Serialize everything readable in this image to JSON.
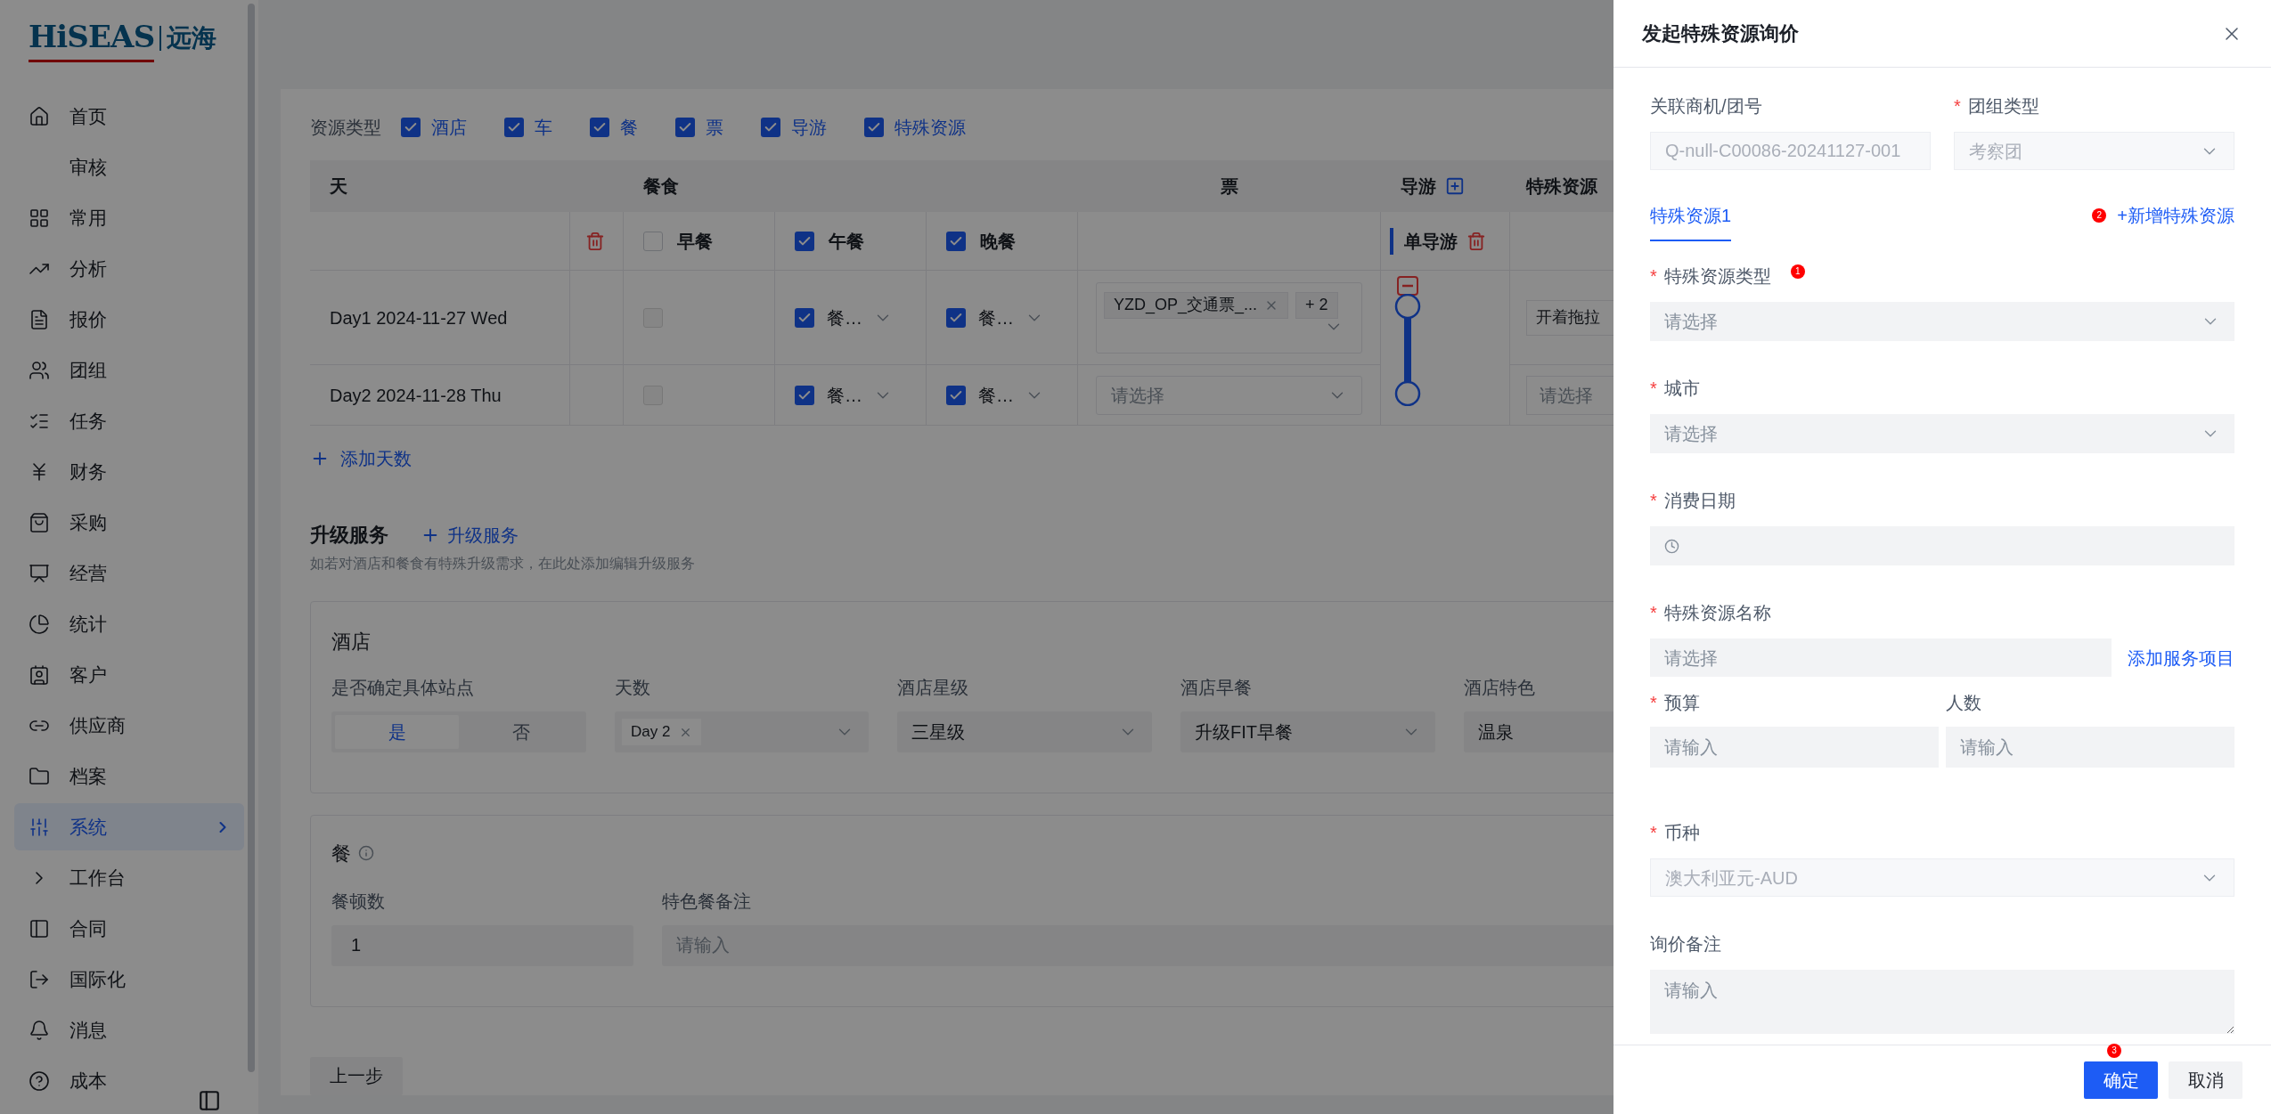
{
  "logo": {
    "brand": "HiSEAS",
    "cn": "远海"
  },
  "sidebar": {
    "items": [
      {
        "label": "首页",
        "selected": false,
        "expandable": false
      },
      {
        "label": "审核",
        "selected": false,
        "expandable": false
      },
      {
        "label": "常用",
        "selected": false,
        "expandable": false
      },
      {
        "label": "分析",
        "selected": false,
        "expandable": false
      },
      {
        "label": "报价",
        "selected": false,
        "expandable": false
      },
      {
        "label": "团组",
        "selected": false,
        "expandable": false
      },
      {
        "label": "任务",
        "selected": false,
        "expandable": false
      },
      {
        "label": "财务",
        "selected": false,
        "expandable": false
      },
      {
        "label": "采购",
        "selected": false,
        "expandable": false
      },
      {
        "label": "经营",
        "selected": false,
        "expandable": false
      },
      {
        "label": "统计",
        "selected": false,
        "expandable": false
      },
      {
        "label": "客户",
        "selected": false,
        "expandable": false
      },
      {
        "label": "供应商",
        "selected": false,
        "expandable": false
      },
      {
        "label": "档案",
        "selected": false,
        "expandable": false
      },
      {
        "label": "系统",
        "selected": true,
        "expandable": true
      },
      {
        "label": "工作台",
        "selected": false,
        "expandable": false
      },
      {
        "label": "合同",
        "selected": false,
        "expandable": false
      },
      {
        "label": "国际化",
        "selected": false,
        "expandable": false
      },
      {
        "label": "消息",
        "selected": false,
        "expandable": false
      },
      {
        "label": "成本",
        "selected": false,
        "expandable": false
      }
    ]
  },
  "resource_types": {
    "label": "资源类型",
    "options": [
      {
        "label": "酒店",
        "checked": true
      },
      {
        "label": "车",
        "checked": true
      },
      {
        "label": "餐",
        "checked": true
      },
      {
        "label": "票",
        "checked": true
      },
      {
        "label": "导游",
        "checked": true
      },
      {
        "label": "特殊资源",
        "checked": true
      }
    ]
  },
  "table": {
    "columns": {
      "day": "天",
      "meals": "餐食",
      "ticket": "票",
      "guide": "导游",
      "special": "特殊资源"
    },
    "meal_columns": [
      {
        "label": "早餐",
        "checked": false
      },
      {
        "label": "午餐",
        "checked": true
      },
      {
        "label": "晚餐",
        "checked": true
      }
    ],
    "guide_mode": "单导游",
    "rows": [
      {
        "day": "Day1 2024-11-27 Wed",
        "meals": [
          {
            "checked": false
          },
          {
            "checked": true,
            "value": "餐…"
          },
          {
            "checked": true,
            "value": "餐…"
          }
        ],
        "ticket": {
          "tags": [
            "YZD_OP_交通票_..."
          ],
          "more": "+ 2"
        },
        "special": {
          "value": "开着拖拉"
        }
      },
      {
        "day": "Day2 2024-11-28 Thu",
        "meals": [
          {
            "checked": false
          },
          {
            "checked": true,
            "value": "餐…"
          },
          {
            "checked": true,
            "value": "餐…"
          }
        ],
        "ticket": {
          "placeholder": "请选择"
        },
        "special": {
          "placeholder": "请选择"
        }
      }
    ]
  },
  "add_day": "添加天数",
  "upgrade": {
    "title": "升级服务",
    "add": "升级服务",
    "hint": "如若对酒店和餐食有特殊升级需求，在此处添加编辑升级服务"
  },
  "hotel": {
    "title": "酒店",
    "site_label": "是否确定具体站点",
    "site_options": [
      {
        "label": "是",
        "selected": true
      },
      {
        "label": "否",
        "selected": false
      }
    ],
    "days_label": "天数",
    "days_tags": [
      "Day 2"
    ],
    "star_label": "酒店星级",
    "star_value": "三星级",
    "breakfast_label": "酒店早餐",
    "breakfast_value": "升级FIT早餐",
    "feature_label": "酒店特色",
    "feature_value": "温泉"
  },
  "meal": {
    "title": "餐",
    "count_label": "餐顿数",
    "count_value": "1",
    "note_label": "特色餐备注",
    "note_placeholder": "请输入"
  },
  "prev_button": "上一步",
  "drawer": {
    "title": "发起特殊资源询价",
    "required_mark": "*",
    "link_label": "关联商机/团号",
    "link_value": "Q-null-C00086-20241127-001",
    "group_type_label": "团组类型",
    "group_type_value": "考察团",
    "tabs": [
      {
        "label": "特殊资源1",
        "selected": true
      }
    ],
    "add_resource": "+新增特殊资源",
    "add_badge": "2",
    "fields": [
      {
        "kind": "select",
        "label": "特殊资源类型",
        "required": true,
        "placeholder": "请选择",
        "badge": "1"
      },
      {
        "kind": "select",
        "label": "城市",
        "required": true,
        "placeholder": "请选择"
      },
      {
        "kind": "date",
        "label": "消费日期",
        "required": true
      },
      {
        "kind": "picker",
        "label": "特殊资源名称",
        "required": true,
        "placeholder": "请选择",
        "action": "添加服务项目"
      }
    ],
    "budget": {
      "label": "预算",
      "required": true,
      "placeholder": "请输入"
    },
    "people": {
      "label": "人数",
      "required": false,
      "placeholder": "请输入"
    },
    "currency": {
      "label": "币种",
      "required": true,
      "value": "澳大利亚元-AUD"
    },
    "remark": {
      "label": "询价备注",
      "required": false,
      "placeholder": "请输入"
    },
    "ok": "确定",
    "ok_badge": "3",
    "cancel": "取消"
  }
}
